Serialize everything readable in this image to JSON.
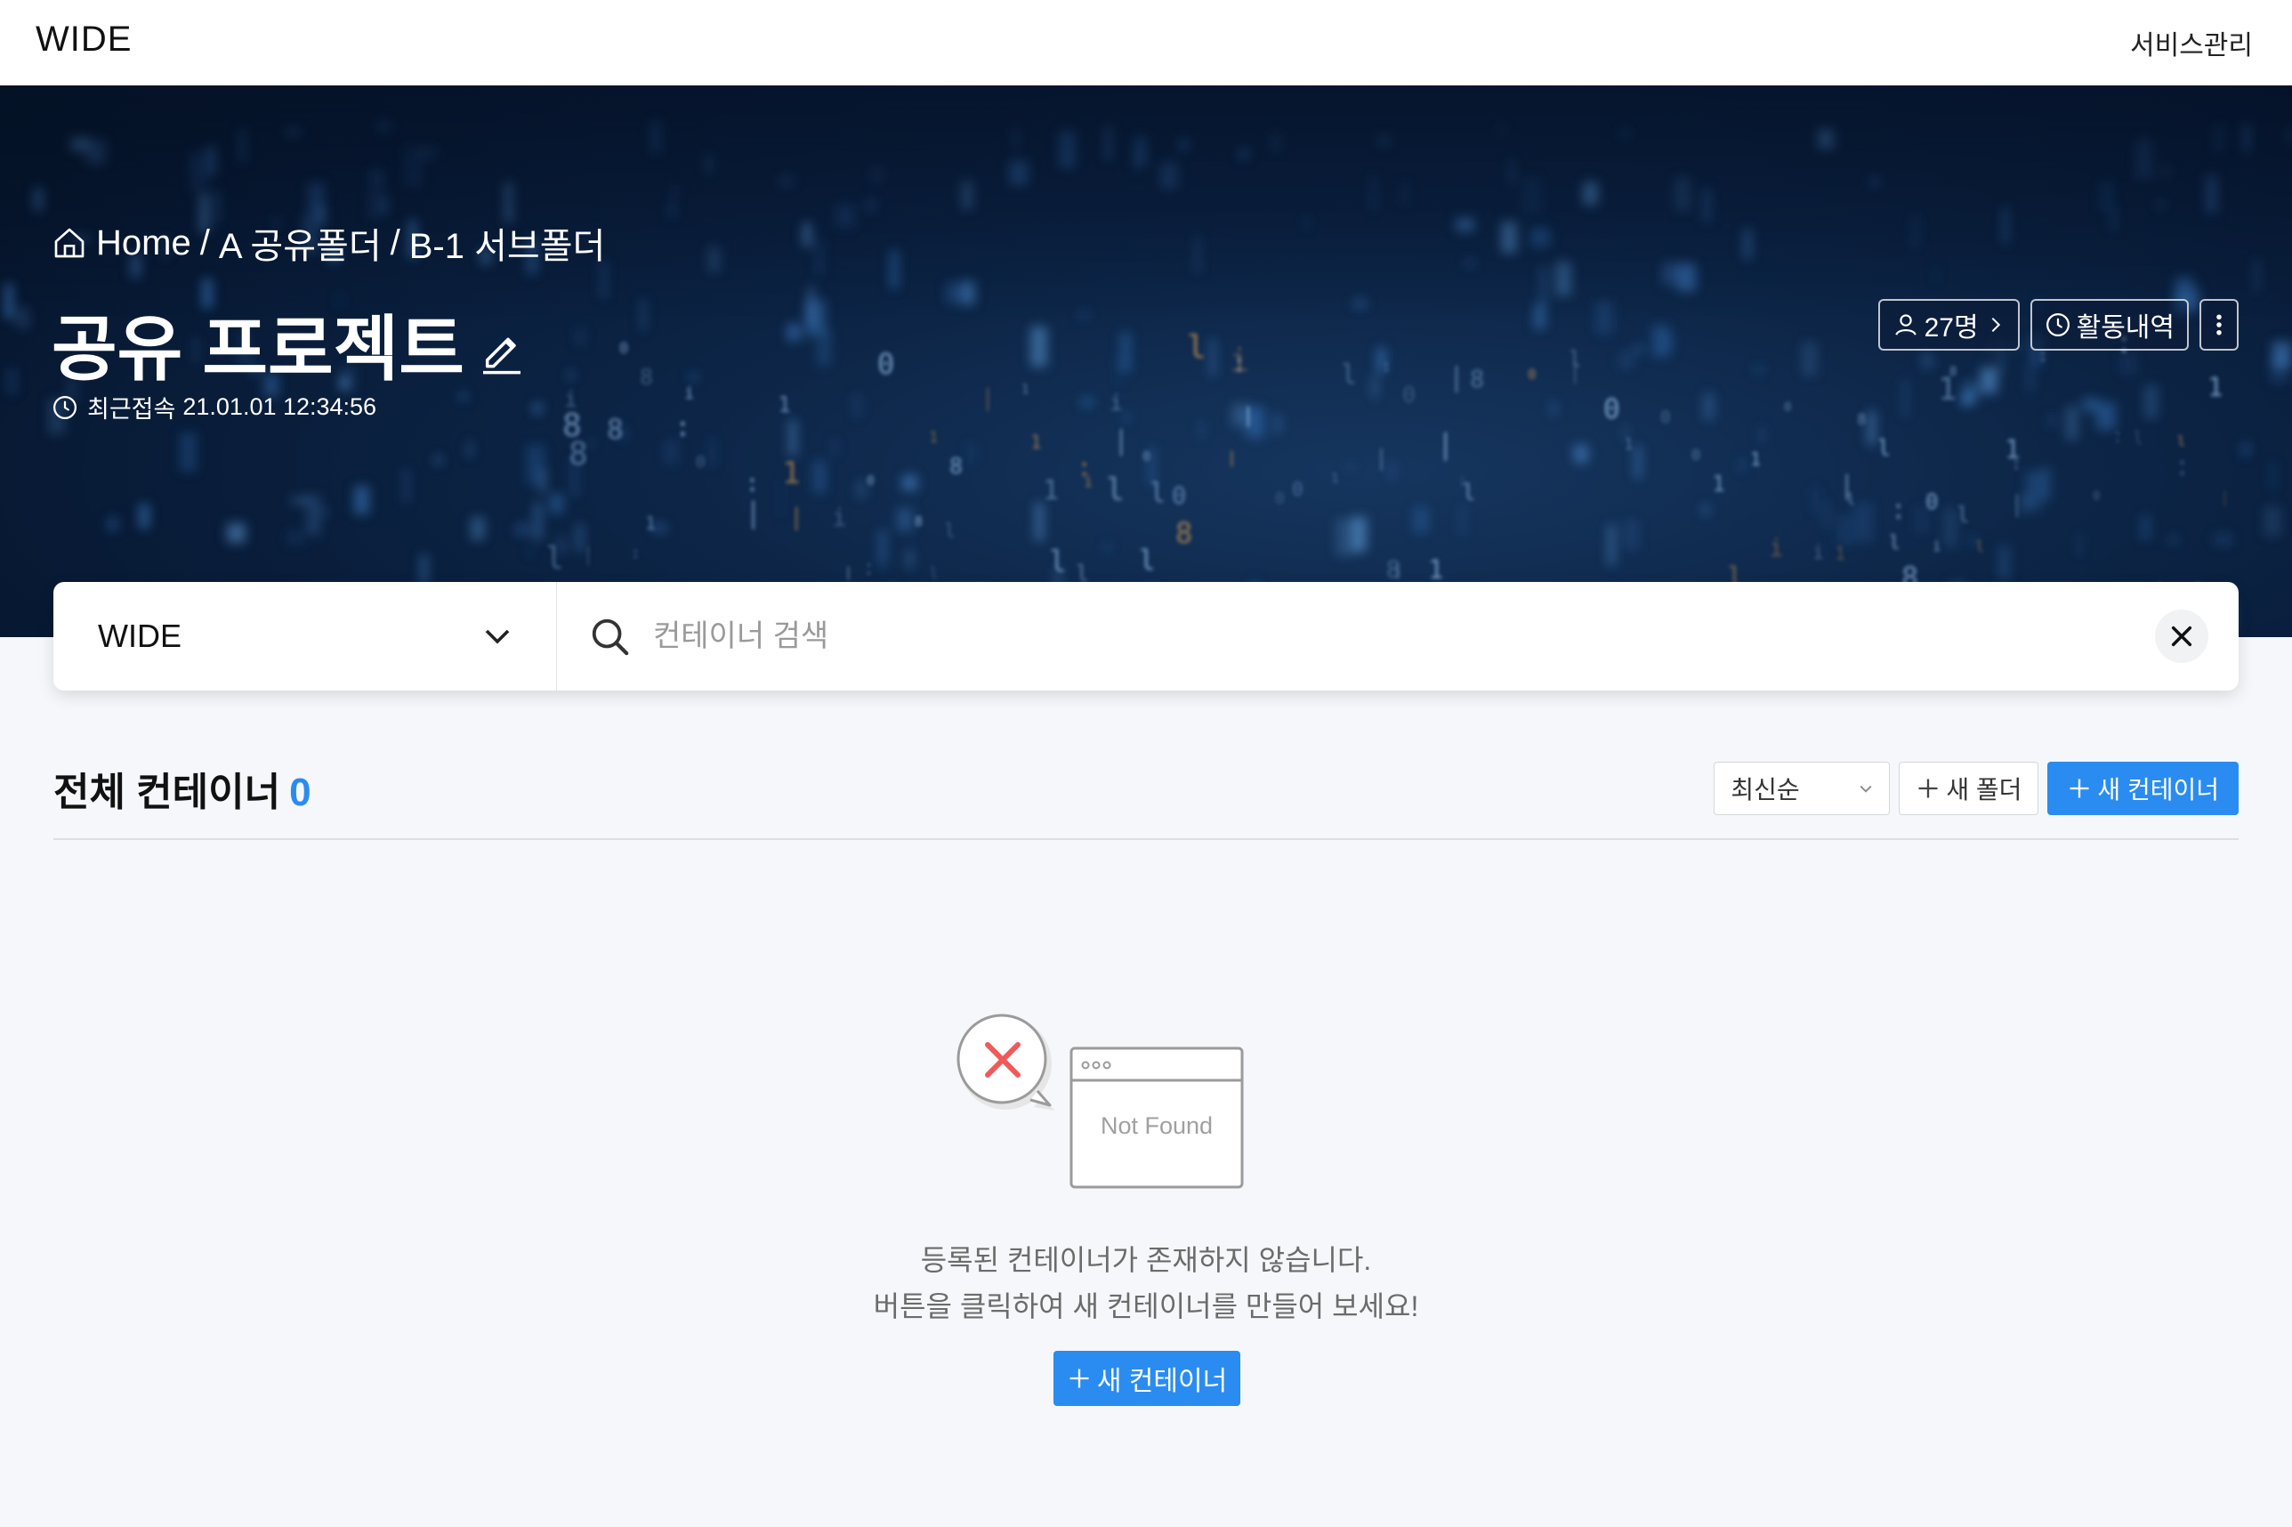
{
  "app": {
    "brand": "WIDE",
    "service_link": "서비스관리"
  },
  "breadcrumb": {
    "items": [
      "Home",
      "A 공유폴더",
      "B-1 서브폴더"
    ],
    "separator": "/"
  },
  "project": {
    "title": "공유 프로젝트",
    "last_access_label": "최근접속",
    "last_access_time": "21.01.01 12:34:56",
    "members_count": "27명",
    "activity_label": "활동내역"
  },
  "search": {
    "workspace": "WIDE",
    "placeholder": "컨테이너 검색"
  },
  "list": {
    "title": "전체 컨테이너",
    "count": "0",
    "sort_value": "최신순",
    "new_folder_label": "새 폴더",
    "new_container_label": "새 컨테이너"
  },
  "empty_state": {
    "illustration_text": "Not Found",
    "line1": "등록된 컨테이너가 존재하지 않습니다.",
    "line2": "버튼을 클릭하여 새 컨테이너를 만들어 보세요!",
    "button_label": "새 컨테이너"
  },
  "colors": {
    "accent": "#2a8cf0",
    "hero_bg": "#0c2445",
    "page_bg": "#f5f7fa",
    "error_red": "#f05a5a"
  },
  "icons": {
    "breadcrumb": "home-icon",
    "title_edit": "pencil-icon",
    "last_access": "clock-icon",
    "members": "user-icon",
    "activity": "clock-icon",
    "more": "kebab-icon",
    "workspace_dropdown": "chevron-down-icon",
    "search": "search-icon",
    "clear": "close-icon",
    "add": "plus-icon"
  }
}
